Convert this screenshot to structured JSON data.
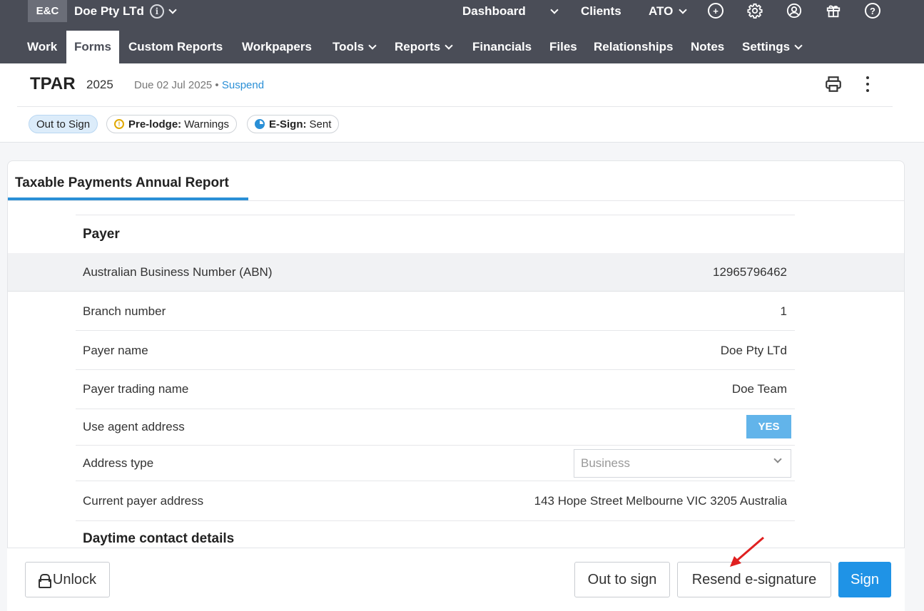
{
  "header": {
    "badge": "E&C",
    "company_name": "Doe Pty LTd",
    "top_nav": [
      {
        "label": "Dashboard"
      },
      {
        "label": "Clients"
      },
      {
        "label": "ATO"
      }
    ]
  },
  "main_nav": [
    {
      "label": "Work"
    },
    {
      "label": "Forms"
    },
    {
      "label": "Custom Reports"
    },
    {
      "label": "Workpapers"
    },
    {
      "label": "Tools"
    },
    {
      "label": "Reports"
    },
    {
      "label": "Financials"
    },
    {
      "label": "Files"
    },
    {
      "label": "Relationships"
    },
    {
      "label": "Notes"
    },
    {
      "label": "Settings"
    }
  ],
  "form": {
    "code": "TPAR",
    "year": "2025",
    "due": "Due 02 Jul 2025 •",
    "suspend_label": "Suspend"
  },
  "status_chips": {
    "out_to_sign": "Out to Sign",
    "prelodge_label": "Pre-lodge:",
    "prelodge_value": "Warnings",
    "esign_label": "E-Sign:",
    "esign_value": "Sent"
  },
  "card": {
    "tab_title": "Taxable Payments Annual Report",
    "payer_section": "Payer",
    "rows": [
      {
        "label": "Australian Business Number (ABN)",
        "value": "12965796462"
      },
      {
        "label": "Branch number",
        "value": "1"
      },
      {
        "label": "Payer name",
        "value": "Doe Pty LTd"
      },
      {
        "label": "Payer trading name",
        "value": "Doe Team"
      },
      {
        "label": "Use agent address",
        "value": "YES"
      },
      {
        "label": "Address type",
        "value": "Business"
      },
      {
        "label": "Current payer address",
        "value": "143 Hope Street Melbourne VIC 3205 Australia"
      }
    ],
    "contact_section": "Daytime contact details"
  },
  "footer": {
    "unlock_label": "Unlock",
    "out_to_sign_label": "Out to sign",
    "resend_label": "Resend e-signature",
    "sign_label": "Sign"
  },
  "colors": {
    "header_bg": "#4a4d57",
    "accent": "#1f93e6",
    "annotation_arrow": "#e02020"
  }
}
